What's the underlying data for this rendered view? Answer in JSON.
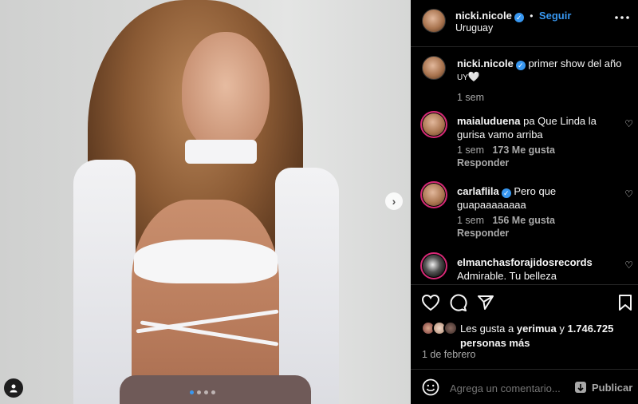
{
  "header": {
    "username": "nicki.nicole",
    "separator": "•",
    "follow_label": "Seguir",
    "location": "Uruguay",
    "more_icon": "more-icon"
  },
  "caption": {
    "username": "nicki.nicole",
    "text_line1": "primer show del año",
    "text_line2": "UY",
    "heart": "🤍",
    "time": "1 sem"
  },
  "comments": [
    {
      "username": "maialuduena",
      "text_line1": "pa Que Linda la",
      "text_line2": "gurisa vamo arriba",
      "time": "1 sem",
      "likes": "173 Me gusta",
      "reply": "Responder"
    },
    {
      "username": "carlaflila",
      "verified": true,
      "text_line1": "Pero que",
      "text_line2": "guapaaaaaaaa",
      "time": "1 sem",
      "likes": "156 Me gusta",
      "reply": "Responder"
    },
    {
      "username": "elmanchasforajidosrecords",
      "text_line1": "Admirable. Tu belleza"
    }
  ],
  "likes": {
    "prefix": "Les gusta a",
    "user": "yerimua",
    "connector": "y",
    "count": "1.746.725",
    "suffix": "personas más"
  },
  "date": "1 de febrero",
  "comment_box": {
    "placeholder": "Agrega un comentario...",
    "post_label": "Publicar"
  },
  "carousel": {
    "next_glyph": "›",
    "pages": 4,
    "active_index": 0
  },
  "colors": {
    "accent": "#3897f0",
    "background": "#000000",
    "text": "#f5f5f5",
    "muted": "#a8a8a8"
  }
}
